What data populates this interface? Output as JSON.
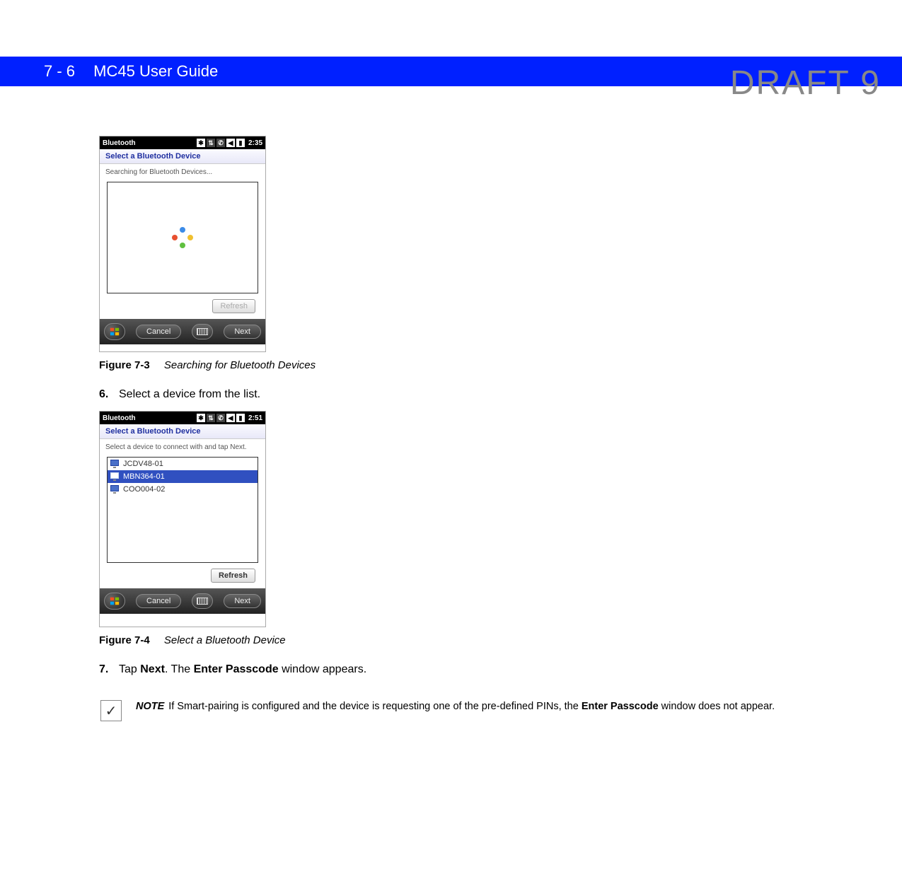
{
  "watermark": "DRAFT 9",
  "header": {
    "page": "7 - 6",
    "title": "MC45 User Guide"
  },
  "figure1": {
    "title": "Bluetooth",
    "time": "2:35",
    "subtitle": "Select a Bluetooth Device",
    "status": "Searching for Bluetooth Devices...",
    "refresh": "Refresh",
    "cancel": "Cancel",
    "next": "Next",
    "caption_label": "Figure 7-3",
    "caption_desc": "Searching for Bluetooth Devices"
  },
  "step6": {
    "num": "6.",
    "text": "Select a device from the list."
  },
  "figure2": {
    "title": "Bluetooth",
    "time": "2:51",
    "subtitle": "Select a Bluetooth Device",
    "status": "Select a device to connect with and tap Next.",
    "devices": [
      {
        "name": "JCDV48-01",
        "selected": false
      },
      {
        "name": "MBN364-01",
        "selected": true
      },
      {
        "name": "COO004-02",
        "selected": false
      }
    ],
    "refresh": "Refresh",
    "cancel": "Cancel",
    "next": "Next",
    "caption_label": "Figure 7-4",
    "caption_desc": "Select a Bluetooth Device"
  },
  "step7": {
    "num": "7.",
    "pre": "Tap ",
    "bold1": "Next",
    "mid": ". The ",
    "bold2": "Enter Passcode",
    "post": " window appears."
  },
  "note": {
    "label": "NOTE",
    "pre": "If Smart-pairing is configured and the device is requesting one of the pre-defined PINs, the ",
    "bold1": "Enter Passcode",
    "post": " window does not appear."
  }
}
